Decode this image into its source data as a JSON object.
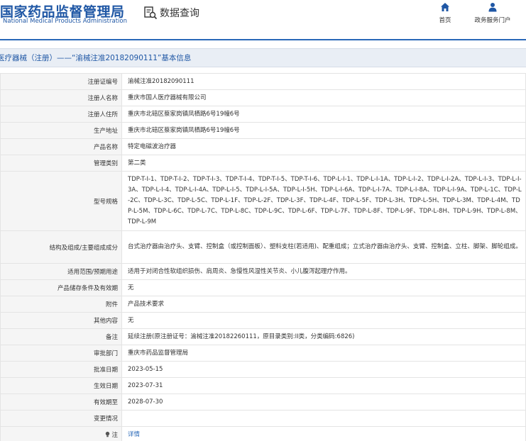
{
  "header": {
    "logo_cn": "国家药品监督管理局",
    "logo_en": "National Medical Products Administration",
    "query_label": "数据查询",
    "nav": [
      {
        "label": "首页",
        "icon": "home-icon"
      },
      {
        "label": "政务服务门户",
        "icon": "user-icon"
      }
    ]
  },
  "colors": {
    "brand": "#1f57a5",
    "accent": "#2968b8",
    "title_bg": "#e9eef5",
    "label_bg": "#f5f5f5"
  },
  "title": "医疗器械（注册）——“渝械注准20182090111”基本信息",
  "rows": [
    {
      "label": "注册证编号",
      "value": "渝械注准20182090111"
    },
    {
      "label": "注册人名称",
      "value": "重庆市国人医疗器械有限公司"
    },
    {
      "label": "注册人住所",
      "value": "重庆市北碚区蔡家岗镇凤栖路6号19幢6号"
    },
    {
      "label": "生产地址",
      "value": "重庆市北碚区蔡家岗镇凤栖路6号19幢6号"
    },
    {
      "label": "产品名称",
      "value": "特定电磁波治疗器"
    },
    {
      "label": "管理类别",
      "value": "第二类"
    },
    {
      "label": "型号规格",
      "value": "TDP-T-I-1、TDP-T-I-2、TDP-T-I-3、TDP-T-I-4、TDP-T-I-5、TDP-T-I-6、TDP-L-I-1、TDP-L-I-1A、TDP-L-I-2、TDP-L-I-2A、TDP-L-I-3、TDP-L-I-3A、TDP-L-I-4、TDP-L-I-4A、TDP-L-I-5、TDP-L-I-5A、TDP-L-I-5H、TDP-L-I-6A、TDP-L-I-7A、TDP-L-I-8A、TDP-L-I-9A、TDP-L-1C、TDP-L-2C、TDP-L-3C、TDP-L-5C、TDP-L-1F、TDP-L-2F、TDP-L-3F、TDP-L-4F、TDP-L-5F、TDP-L-3H、TDP-L-5H、TDP-L-3M、TDP-L-4M、TDP-L-5M、TDP-L-6C、TDP-L-7C、TDP-L-8C、TDP-L-9C、TDP-L-6F、TDP-L-7F、TDP-L-8F、TDP-L-9F、TDP-L-8H、TDP-L-9H、TDP-L-8M、TDP-L-9M"
    },
    {
      "label": "结构及组成/主要组成成分",
      "value": "台式治疗器由治疗头、支臂、控制盒（或控制面板）、塑料支柱(若适用)、配重组成；立式治疗器由治疗头、支臂、控制盒、立柱、脚架、脚轮组成。"
    },
    {
      "label": "适用范围/预期用途",
      "value": "适用于对闭合性软组织损伤、肩周炎、急慢性风湿性关节炎、小儿腹泻起理疗作用。"
    },
    {
      "label": "产品储存条件及有效期",
      "value": "无"
    },
    {
      "label": "附件",
      "value": "产品技术要求"
    },
    {
      "label": "其他内容",
      "value": "无"
    },
    {
      "label": "备注",
      "value": "延续注册(原注册证号：渝械注准20182260111，原目录类别:II类，分类编码:6826)"
    },
    {
      "label": "审批部门",
      "value": "重庆市药品监督管理局"
    },
    {
      "label": "批准日期",
      "value": "2023-05-15"
    },
    {
      "label": "生效日期",
      "value": "2023-07-31"
    },
    {
      "label": "有效期至",
      "value": "2028-07-30"
    },
    {
      "label": "变更情况",
      "value": ""
    },
    {
      "label": "注",
      "value": "详情"
    }
  ]
}
